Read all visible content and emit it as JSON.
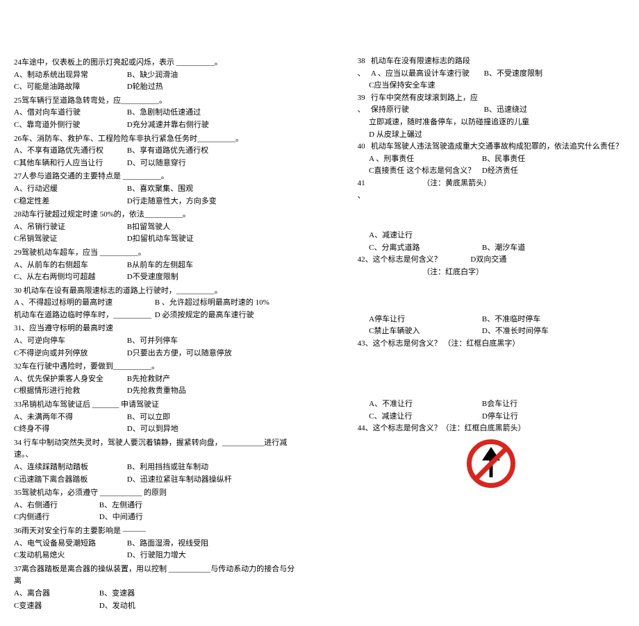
{
  "left": {
    "q24": {
      "stem": "24车途中，仪表板上的图示灯亮起或闪烁，表示 __________。",
      "A": "A、制动系统出现异常",
      "B": "B、缺少润滑油",
      "C": "C、可能是油路故障",
      "D": "D轮胎过热"
    },
    "q25": {
      "stem": "25驾车辆行至道路急转弯处，应__________。",
      "A": "A、借对向车道行驶",
      "B": "B、急剧制动低速通过",
      "C": "C、靠弯道外侧行驶",
      "D": "D充分减速并靠右侧行驶"
    },
    "q26": {
      "stem": "26车、消防车、救护车、工程险险车非执行紧急任务时__________。",
      "A": "A、不享有道路优先通行权",
      "B": "B、享有道路优先通行权",
      "C": "C其他车辆和行人应当让行",
      "D": "D、可以随意穿行"
    },
    "q27": {
      "stem": "27人参与道路交通的主要特点是 __________。",
      "A": "A、行动迟缓",
      "B": "B、喜欢聚集、围观",
      "C": "C稳定性差",
      "D": "D行走随意性大，方向多变"
    },
    "q28": {
      "stem": "28动车行驶超过规定时速   50%的，依法__________。",
      "A": "A、吊销行驶证",
      "B": "B扣留驾驶人",
      "C": "C吊销驾驶证",
      "D": "D扣留机动车驾驶证"
    },
    "q29": {
      "stem": "29驾驶机动车超车，应当 __________。",
      "A": "A、从前车的右侧超车",
      "B": "B从前车的左侧超车",
      "C": "C、从左右两侧均可超越",
      "D": "D不受速度限制"
    },
    "q30": {
      "stem": "30 机动车在设有最高限速标志的道路上行驶时，__________。",
      "A": "A 、不得超过标明的最高时速",
      "B": "B 、允许超过标明最高时速的   10%",
      "C": "机动车在道路边临时停车时，__________",
      "D": "D 必须按规定的最高车速行驶"
    },
    "q31": {
      "stem": "31、应当遵守标明的最高时速",
      "A": "A、可逆向停车",
      "B": "B、可并列停车",
      "C": "C不得逆向或并列停放",
      "D": "D只要出去方便，可以随意停放"
    },
    "q32": {
      "stem": "32车在行驶中遇险时，要做到__________。",
      "A": "A、优先保护乘客人身安全",
      "B": "B先抢救财产",
      "C": "C根据情形进行抢救",
      "D": "D先抢救贵重物品"
    },
    "q33": {
      "stem": "33吊销机动车驾驶证后 _______ 申请驾驶证",
      "A": "A、未满两年不得",
      "B": "B、可以立即",
      "C": "C终身不得",
      "D": "D、可以到异地"
    },
    "q34": {
      "stem": "34 行车中制动突然失灵时，驾驶人要沉着镇静，握紧转向盘，___________进行减速。、",
      "A": "A、连续踩踏制动踏板",
      "B": "B、利用挡挡或驻车制动",
      "C": "C迅速踏下离合器踏板",
      "D": "D、迅速拉紧驻车制动器操纵杆"
    },
    "q35": {
      "stem": "35驾驶机动车，必须遵守 ___________ 的原则",
      "A": "A、右侧通行",
      "B": "B、左侧通行",
      "C": "C内侧通行",
      "D": "D、中间通行"
    },
    "q36": {
      "stem": "36雨天对安全行车的主要影响是 ———",
      "A": "A、电气设备易受潮短路",
      "B": "B、路面湿滑，视线受阻",
      "C": "C发动机易熄火",
      "D": "D、行驶阻力增大"
    },
    "q37": {
      "stem": "37离合器踏板是离合器的操纵装置，用以控制 ___________与传动系动力的接合与分离",
      "A": "A、离合器",
      "B": "B、变速器",
      "C": "C变速器",
      "D": "D、发动机"
    }
  },
  "right": {
    "q38": {
      "num": "38",
      "stem": "机动车在没有限速标志的路段",
      "A": "A 、应当以最高设计车速行驶",
      "B": "B、不受速度限制",
      "C": "C应当保持安全车速",
      "D": ""
    },
    "q39": {
      "num": "39",
      "stem": "行车中突然有皮球滚到路上，应",
      "A": "保持原行驶",
      "B": "B、迅速绕过",
      "C": "立即减速，随时准备停车，以防碰撞追逐的儿童",
      "D": "D   从皮球上碾过"
    },
    "q40": {
      "num": "40",
      "stem": "机动车驾驶人违法驾驶造成重大交通事故构成犯罪的，依法追究什么责任？",
      "A": "A 、刑事责任",
      "B": "B、民事责任",
      "C": "C直接责任 这个标志是何含义？",
      "D": "D经济责任"
    },
    "q41": {
      "num": "41",
      "stem": "（注：黄底黑箭头）",
      "A": "A、减速让行",
      "B": "",
      "C": "C、分离式道路",
      "D": "B、潮汐车道"
    },
    "q42": {
      "num": "42、这个标志是何含义？",
      "D": "D双向交通",
      "note": "（注：红底白字）"
    },
    "q42opts": {
      "A": "A停车让行",
      "B": "B、不准临时停车",
      "C": "C禁止车辆驶入",
      "D": "D、不准长时间停车"
    },
    "q43": {
      "num": "43、这个标志是何含义？   （注：红框白底黑字）"
    },
    "q43opts": {
      "A": "A、不准让行",
      "B": "B会车让行",
      "C": "C、减速让行",
      "D": "D停车让行"
    },
    "q44": {
      "num": "44、这个标志是何含义？（注：红框白底黑箭头）"
    }
  }
}
